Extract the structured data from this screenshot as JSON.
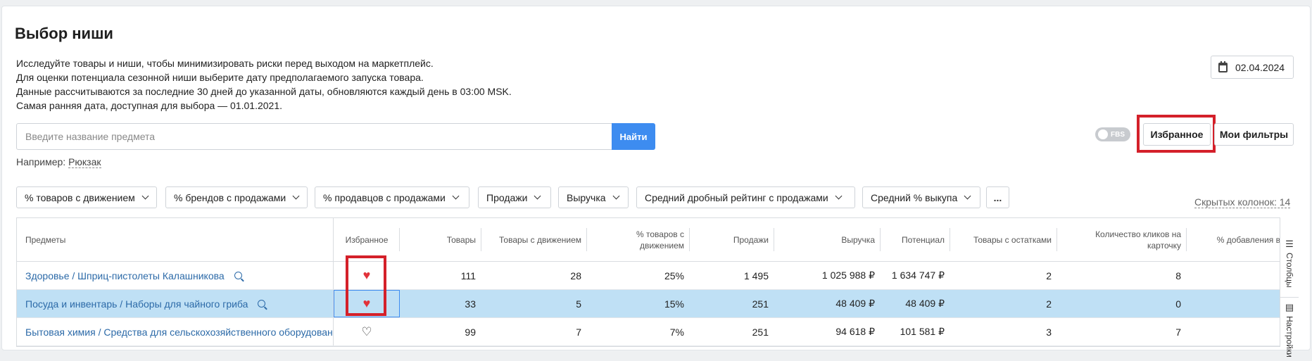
{
  "page": {
    "title": "Выбор ниши",
    "description": [
      "Исследуйте товары и ниши, чтобы минимизировать риски перед выходом на маркетплейс.",
      "Для оценки потенциала сезонной ниши выберите дату предполагаемого запуска товара.",
      "Данные рассчитываются за последние 30 дней до указанной даты, обновляются каждый день в 03:00 MSK.",
      "Самая ранняя дата, доступная для выбора — 01.01.2021."
    ],
    "date": "02.04.2024"
  },
  "search": {
    "placeholder": "Введите название предмета",
    "button": "Найти",
    "example_prefix": "Например:",
    "example_link": "Рюкзак"
  },
  "toolbar": {
    "fbs_label": "FBS",
    "favorites_label": "Избранное",
    "my_filters_label": "Мои фильтры"
  },
  "filters": [
    "% товаров с движением",
    "% брендов с продажами",
    "% продавцов с продажами",
    "Продажи",
    "Выручка",
    "Средний дробный рейтинг с продажами",
    "Средний % выкупа"
  ],
  "more_label": "...",
  "hidden_columns": "Скрытых колонок: 14",
  "table": {
    "headers": {
      "subject": "Предметы",
      "favorite": "Избранное",
      "goods": "Товары",
      "goods_moving": "Товары с движением",
      "pct_moving": "% товаров с движением",
      "sales": "Продажи",
      "revenue": "Выручка",
      "potential": "Потенциал",
      "in_stock": "Товары с остатками",
      "clicks": "Количество кликов на карточку",
      "add_pct": "% добавления в"
    },
    "rows": [
      {
        "subject": "Здоровье / Шприц-пистолеты Калашникова",
        "favorite": "♥",
        "goods": "111",
        "goods_moving": "28",
        "pct_moving": "25%",
        "sales": "1 495",
        "revenue": "1 025 988 ₽",
        "potential": "1 634 747 ₽",
        "in_stock": "2",
        "clicks": "8"
      },
      {
        "subject": "Посуда и инвентарь / Наборы для чайного гриба",
        "favorite": "♥",
        "goods": "33",
        "goods_moving": "5",
        "pct_moving": "15%",
        "sales": "251",
        "revenue": "48 409 ₽",
        "potential": "48 409 ₽",
        "in_stock": "2",
        "clicks": "0"
      },
      {
        "subject": "Бытовая химия / Средства для сельскохозяйственного оборудования",
        "favorite": "♡",
        "goods": "99",
        "goods_moving": "7",
        "pct_moving": "7%",
        "sales": "251",
        "revenue": "94 618 ₽",
        "potential": "101 581 ₽",
        "in_stock": "3",
        "clicks": "7"
      }
    ]
  },
  "side_panel": {
    "columns_label": "Столбцы",
    "settings_label": "Настройки"
  },
  "colors": {
    "accent": "#3d8cf0",
    "selected_row": "#bfe0f5",
    "highlight": "#d4202a",
    "heart": "#e2323a",
    "link": "#2c6aa8"
  }
}
